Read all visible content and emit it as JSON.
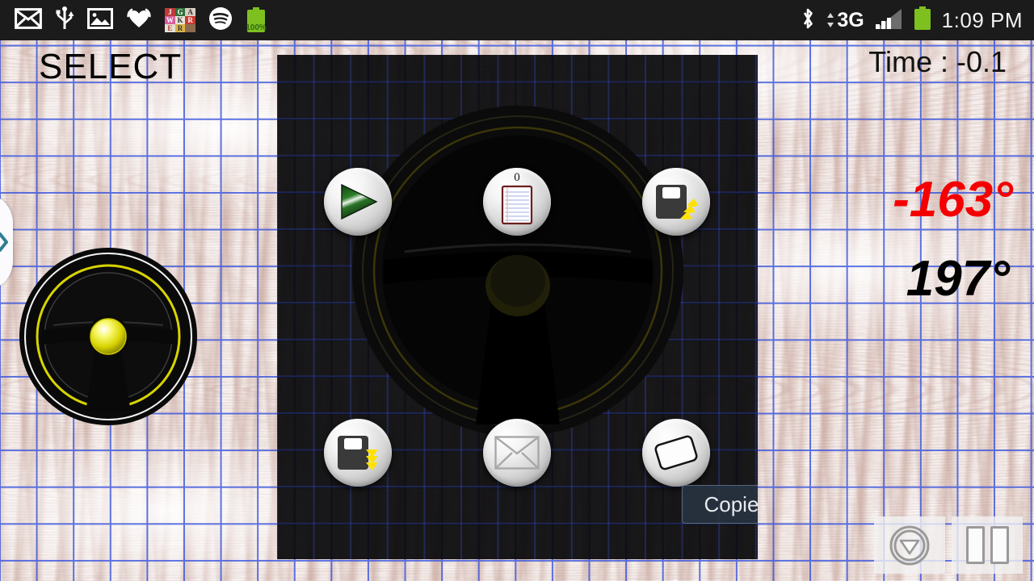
{
  "statusbar": {
    "icons": [
      {
        "name": "mail-icon",
        "label": "Mail"
      },
      {
        "name": "usb-icon",
        "label": "USB"
      },
      {
        "name": "gallery-icon",
        "label": "Gallery"
      },
      {
        "name": "iheartradio-icon",
        "label": "iHeartRadio"
      },
      {
        "name": "wordpress-tile-icon",
        "label": "Word Tiles"
      },
      {
        "name": "spotify-icon",
        "label": "Spotify"
      },
      {
        "name": "battery-app-icon",
        "label": "Battery"
      }
    ],
    "battery_app_percent": "100%",
    "tiles": [
      "J",
      "G",
      "A",
      "W",
      "K",
      "R",
      "E",
      "R",
      ""
    ],
    "bluetooth": "bluetooth-icon",
    "network_type": "3G",
    "signal": "signal-bars-icon",
    "battery": "battery-icon",
    "clock": "1:09 PM"
  },
  "overlay": {
    "select_label": "SELECT",
    "time_label": "Time : -0.1",
    "angle_signed": "-163°",
    "angle_absolute": "197°",
    "angle_signed_color": "#f40000",
    "angle_absolute_color": "#000000",
    "drawer_handle_icon": "chevron-right-icon",
    "wheel_widget_icon": "steering-wheel-icon"
  },
  "panel": {
    "background_icon": "steering-wheel-watermark",
    "buttons": [
      {
        "id": "play",
        "name": "play-button",
        "icon": "play-triangle-icon",
        "caption": ""
      },
      {
        "id": "notes",
        "name": "notepad-button",
        "icon": "lined-notepad-icon",
        "caption": "0"
      },
      {
        "id": "load",
        "name": "load-button",
        "icon": "floppy-up-arrows-icon",
        "caption": ""
      },
      {
        "id": "save",
        "name": "save-button",
        "icon": "floppy-down-arrows-icon",
        "caption": ""
      },
      {
        "id": "mail",
        "name": "send-mail-button",
        "icon": "envelope-icon",
        "caption": ""
      },
      {
        "id": "screen",
        "name": "screen-rotate-button",
        "icon": "tilted-screen-icon",
        "caption": ""
      }
    ]
  },
  "toast": {
    "message": "Copied to clipboard"
  },
  "navbar": {
    "back_button": "back-circle-triangle-icon",
    "pause_button": "pause-icon"
  },
  "theme": {
    "grid_line": "#3a55dd",
    "paper": "#fdfbfa",
    "panel": "#08080a",
    "accent_yellow": "#d9d400",
    "toast_bg": "#283442"
  }
}
